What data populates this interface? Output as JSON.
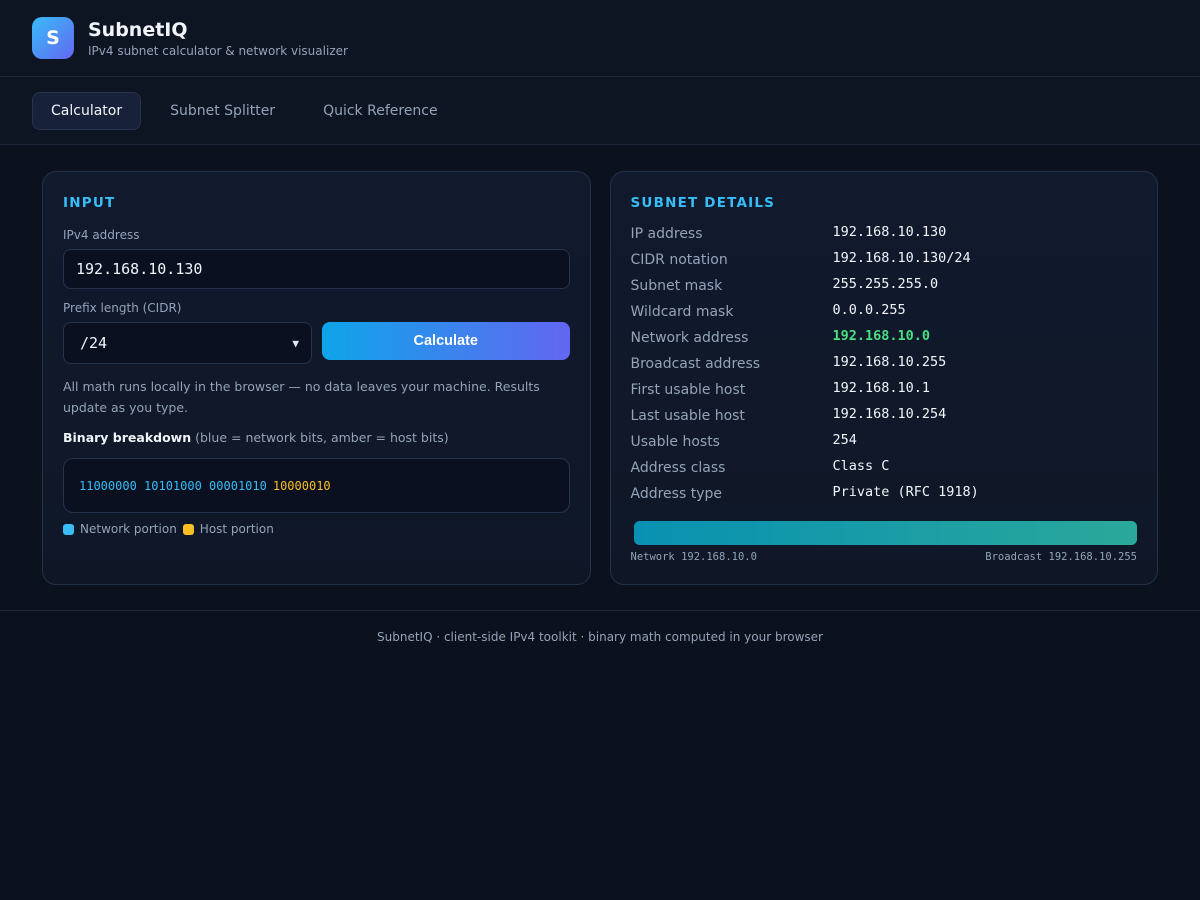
{
  "app": {
    "logo_letter": "S",
    "title": "SubnetIQ",
    "subtitle": "IPv4 subnet calculator & network visualizer"
  },
  "tabs": [
    {
      "label": "Calculator",
      "active": true
    },
    {
      "label": "Subnet Splitter",
      "active": false
    },
    {
      "label": "Quick Reference",
      "active": false
    }
  ],
  "input": {
    "heading": "INPUT",
    "ip_label": "IPv4 address",
    "ip_value": "192.168.10.130",
    "prefix_label": "Prefix length (CIDR)",
    "prefix_value": "/24",
    "calculate_label": "Calculate",
    "note": "All math runs locally in the browser — no data leaves your machine. Results update as you type.",
    "binary_title": "Binary breakdown",
    "binary_hint": "(blue = network bits, amber = host bits)",
    "binary_network": "11000000 10101000 00001010",
    "binary_host": "10000010",
    "legend_network": "Network portion",
    "legend_host": "Host portion"
  },
  "details": {
    "heading": "SUBNET DETAILS",
    "rows": [
      {
        "label": "IP address",
        "value": "192.168.10.130"
      },
      {
        "label": "CIDR notation",
        "value": "192.168.10.130/24"
      },
      {
        "label": "Subnet mask",
        "value": "255.255.255.0"
      },
      {
        "label": "Wildcard mask",
        "value": "0.0.0.255"
      },
      {
        "label": "Network address",
        "value": "192.168.10.0"
      },
      {
        "label": "Broadcast address",
        "value": "192.168.10.255"
      },
      {
        "label": "First usable host",
        "value": "192.168.10.1"
      },
      {
        "label": "Last usable host",
        "value": "192.168.10.254"
      },
      {
        "label": "Usable hosts",
        "value": "254"
      },
      {
        "label": "Address class",
        "value": "Class C"
      },
      {
        "label": "Address type",
        "value": "Private (RFC 1918)"
      }
    ],
    "range_start_label": "Network 192.168.10.0",
    "range_end_label": "Broadcast 192.168.10.255",
    "range_fraction": 1.0
  },
  "footer": "SubnetIQ · client-side IPv4 toolkit · binary math computed in your browser",
  "colors": {
    "accent": "#38bdf8",
    "network_bits": "#38bdf8",
    "host_bits": "#fbbf24",
    "network_address": "#4ade80"
  }
}
